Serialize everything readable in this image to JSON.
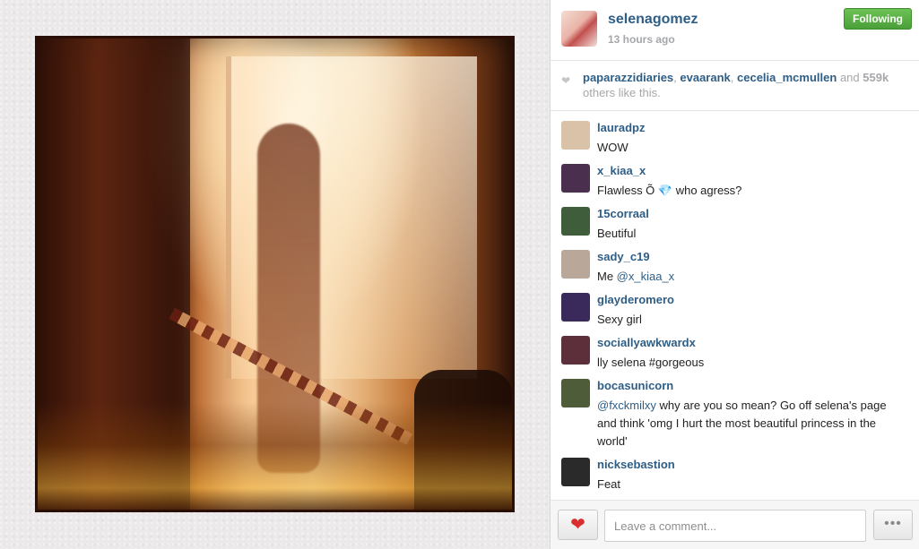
{
  "post": {
    "owner": "selenagomez",
    "time": "13 hours ago",
    "follow_label": "Following"
  },
  "likes": {
    "users": [
      "paparazzidiaries",
      "evaarank",
      "cecelia_mcmullen"
    ],
    "and_text": "and",
    "count": "559k",
    "suffix": "others like this."
  },
  "comments": [
    {
      "user": "lauradpz",
      "text": "WOW",
      "avatar_color": "#d9c2a8"
    },
    {
      "user": "x_kiaa_x",
      "text_before": "Flawless Õ ",
      "gem": "💎",
      "text_after": " who agress?",
      "avatar_color": "#4b2f4f"
    },
    {
      "user": "15corraal",
      "text": "Beutiful",
      "avatar_color": "#3f5d3a"
    },
    {
      "user": "sady_c19",
      "text_prefix": "Me ",
      "mention": "@x_kiaa_x",
      "avatar_color": "#b9a89a"
    },
    {
      "user": "glayderomero",
      "text": "Sexy girl",
      "avatar_color": "#3a2a5c"
    },
    {
      "user": "sociallyawkwardx",
      "text": "lly selena #gorgeous",
      "avatar_color": "#5c2f3b"
    },
    {
      "user": "bocasunicorn",
      "mention": "@fxckmilxy",
      "text": " why are you so mean? Go off selena's page and think 'omg I hurt the most beautiful princess in the world'",
      "avatar_color": "#4e5c3a"
    },
    {
      "user": "nicksebastion",
      "text": "Feat",
      "avatar_color": "#2a2a2a"
    }
  ],
  "footer": {
    "comment_placeholder": "Leave a comment...",
    "more_label": "•••"
  },
  "icons": {
    "like": "heart-icon",
    "more": "ellipsis-icon",
    "likes_heart": "small-heart-icon"
  },
  "colors": {
    "link_blue": "#2e5e86",
    "follow_green": "#5cb346",
    "heart_red": "#d9302f"
  }
}
